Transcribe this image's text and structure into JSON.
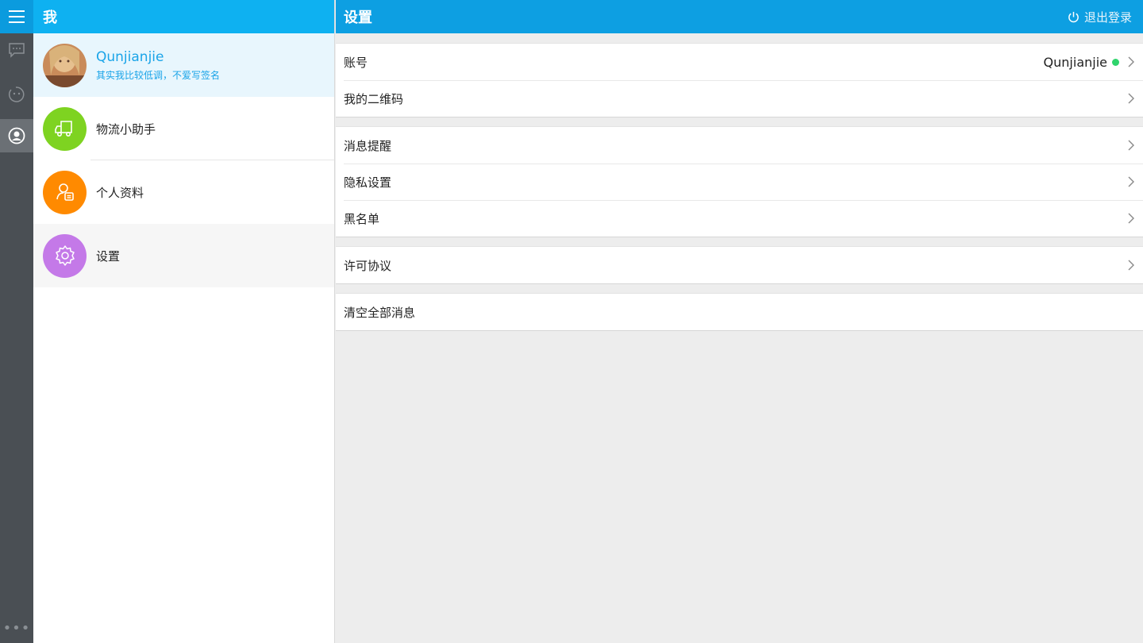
{
  "rail": {
    "items": [
      "chat-icon",
      "emoji-icon",
      "contact-icon"
    ],
    "more": "•••"
  },
  "middle": {
    "header_title": "我",
    "profile": {
      "name": "Qunjianjie",
      "signature": "其实我比较低调，不爱写签名"
    },
    "menu": [
      {
        "label": "物流小助手",
        "icon": "truck-icon",
        "color": "#7ed321"
      },
      {
        "label": "个人资料",
        "icon": "profile-card-icon",
        "color": "#ff8a00"
      },
      {
        "label": "设置",
        "icon": "gear-icon",
        "color": "#c479e8"
      }
    ]
  },
  "settings": {
    "title": "设置",
    "logout_label": "退出登录",
    "groups": [
      [
        {
          "label": "账号",
          "value": "Qunjianjie"
        },
        {
          "label": "我的二维码"
        }
      ],
      [
        {
          "label": "消息提醒"
        },
        {
          "label": "隐私设置"
        },
        {
          "label": "黑名单"
        }
      ],
      [
        {
          "label": "许可协议"
        }
      ],
      [
        {
          "label": "清空全部消息"
        }
      ]
    ]
  },
  "colors": {
    "accent": "#0eb1f1",
    "online": "#2fd46c"
  }
}
